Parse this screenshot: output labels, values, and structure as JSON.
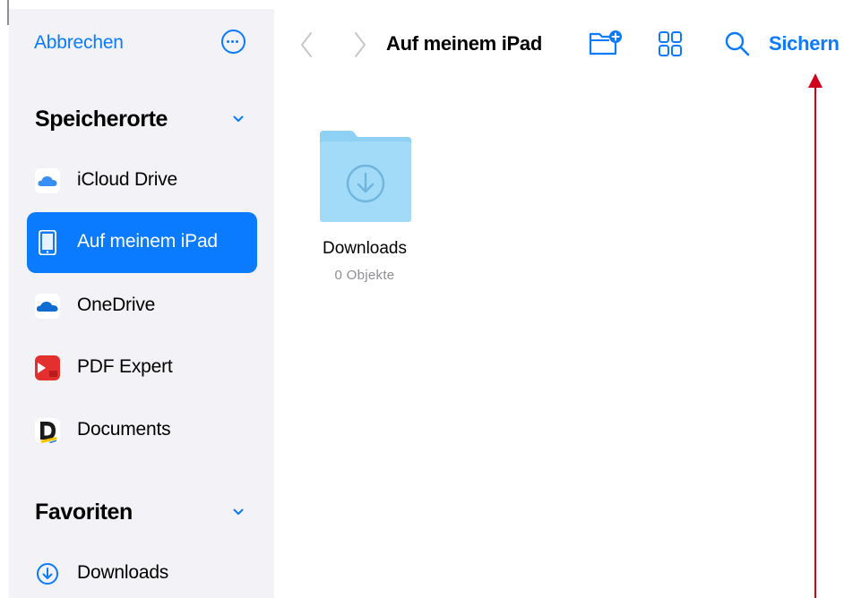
{
  "sidebar": {
    "cancel_label": "Abbrechen",
    "sections": {
      "locations": {
        "title": "Speicherorte",
        "items": [
          {
            "label": "iCloud Drive",
            "icon": "icloud-icon"
          },
          {
            "label": "Auf meinem iPad",
            "icon": "ipad-icon",
            "selected": true
          },
          {
            "label": "OneDrive",
            "icon": "onedrive-icon"
          },
          {
            "label": "PDF Expert",
            "icon": "pdf-expert-icon"
          },
          {
            "label": "Documents",
            "icon": "documents-app-icon"
          }
        ]
      },
      "favorites": {
        "title": "Favoriten",
        "items": [
          {
            "label": "Downloads",
            "icon": "downloads-icon"
          }
        ]
      }
    }
  },
  "toolbar": {
    "title": "Auf meinem iPad",
    "save_label": "Sichern"
  },
  "content": {
    "folders": [
      {
        "name": "Downloads",
        "count": "0 Objekte"
      }
    ]
  },
  "colors": {
    "accent": "#0a7aff",
    "sidebar_bg": "#f2f2f7",
    "folder": "#8fd0f5",
    "annotation": "#d0021b"
  }
}
